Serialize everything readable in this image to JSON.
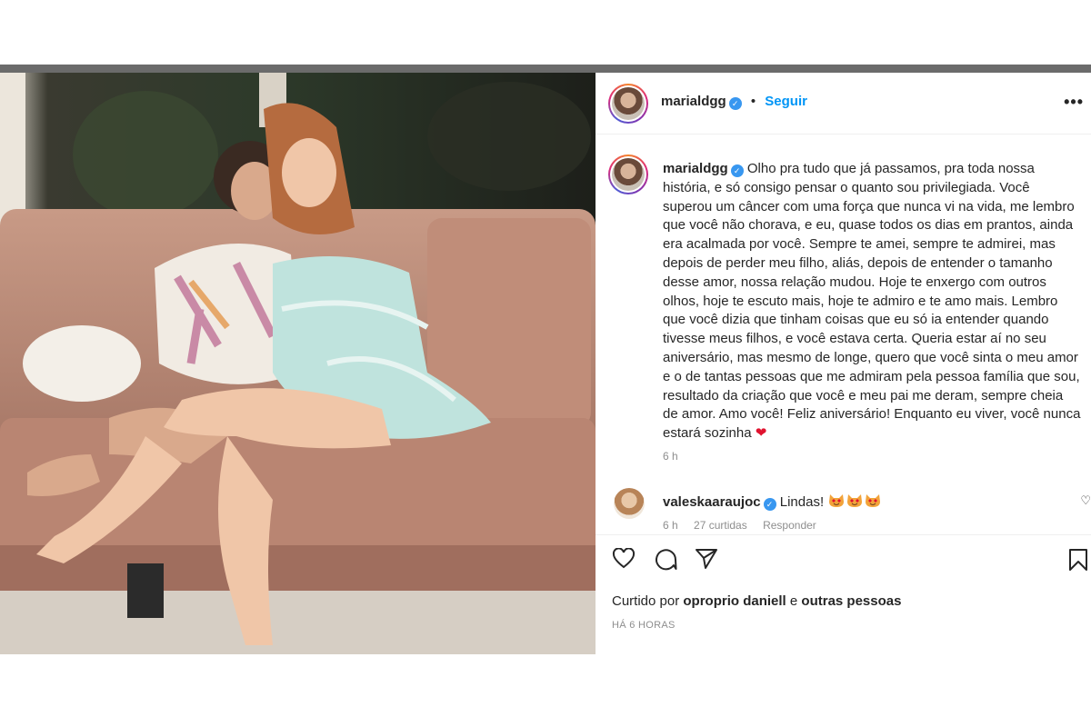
{
  "post": {
    "username": "marialdgg",
    "separator": "•",
    "follow_label": "Seguir",
    "more_label": "•••",
    "caption_user": "marialdgg",
    "caption_text": "Olho pra tudo que já passamos, pra toda nossa história, e só consigo pensar o quanto sou privilegiada. Você superou um câncer com uma força que nunca vi na vida, me lembro que você não chorava, e eu, quase todos os dias em prantos, ainda era acalmada por você. Sempre te amei, sempre te admirei, mas depois de perder meu filho, aliás, depois de entender o tamanho desse amor, nossa relação mudou. Hoje te enxergo com outros olhos, hoje te escuto mais, hoje te admiro e te amo mais. Lembro que você dizia que tinham coisas que eu só ia entender quando tivesse meus filhos, e você estava certa. Queria estar aí no seu aniversário, mas mesmo de longe, quero que você sinta o meu amor e o de tantas pessoas que me admiram pela pessoa família que sou, resultado da criação que você e meu pai me deram, sempre cheia de amor. Amo você! Feliz aniversário! Enquanto eu viver, você nunca estará sozinha",
    "caption_time": "6 h"
  },
  "comment": {
    "username": "valeskaaraujoc",
    "text": "Lindas!",
    "time": "6 h",
    "likes": "27 curtidas",
    "reply": "Responder"
  },
  "likes": {
    "prefix": "Curtido por",
    "user": "oproprio daniell",
    "conjunction": "e",
    "others": "outras pessoas"
  },
  "posted_ago": "HÁ 6 HORAS",
  "icons": {
    "heart": "heart-outline-icon",
    "comment": "comment-icon",
    "share": "share-icon",
    "save": "bookmark-icon",
    "verified": "verified-badge-icon",
    "emoji": "heart-eyes-cat-emoji"
  },
  "colors": {
    "follow": "#0095f6",
    "verified": "#3897f0",
    "heart": "#e0132f",
    "muted": "#8e8e8e"
  }
}
